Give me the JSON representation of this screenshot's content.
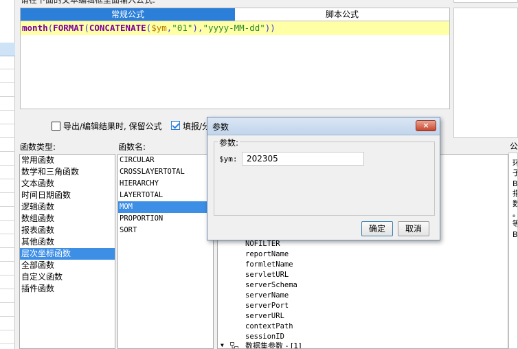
{
  "instruction": "请在下面的文本编辑框里面输入公式:",
  "tabs": {
    "regular": "常规公式",
    "script": "脚本公式"
  },
  "formula": {
    "p1": "month",
    "p2": "(",
    "p3": "FORMAT",
    "p4": "(",
    "p5": "CONCATENATE",
    "p6": "(",
    "p7": "$ym",
    "p8": ",",
    "p9": "\"01\"",
    "p10": ")",
    "p11": ",",
    "p12": "\"yyyy-MM-dd\"",
    "p13": "))"
  },
  "options": {
    "keep_formula": "导出/编辑结果时, 保留公式",
    "fill_report": "填报/分"
  },
  "function_types": {
    "label": "函数类型:",
    "items": [
      "常用函数",
      "数学和三角函数",
      "文本函数",
      "时间日期函数",
      "逻辑函数",
      "数组函数",
      "报表函数",
      "其他函数",
      "层次坐标函数",
      "全部函数",
      "自定义函数",
      "插件函数"
    ],
    "selected_index": 8
  },
  "function_names": {
    "label": "函数名:",
    "items": [
      "CIRCULAR",
      "CROSSLAYERTOTAL",
      "HIERARCHY",
      "LAYERTOTAL",
      "MOM",
      "PROPORTION",
      "SORT"
    ],
    "selected_index": 4
  },
  "tree": {
    "items": [
      "NOFILTER",
      "reportName",
      "formletName",
      "servletURL",
      "serverSchema",
      "serverName",
      "serverPort",
      "serverURL",
      "contextPath",
      "sessionID"
    ],
    "bottom_node": "数据集参数 - [1]"
  },
  "description": {
    "label": "公",
    "lines": [
      "环",
      "子",
      "B",
      "指",
      "数",
      "。",
      "等",
      "B"
    ]
  },
  "dialog": {
    "title": "参数",
    "close": "×",
    "group_label": "参数:",
    "param_label": "$ym:",
    "param_value": "202305",
    "ok": "确定",
    "cancel": "取消"
  },
  "colors": {
    "tab_active": "#2b7fd8",
    "selection": "#3d8ee5",
    "editor_highlight": "#ffffa6",
    "keyword": "#7a00a0",
    "variable": "#b77a00",
    "string": "#2a8a2a"
  }
}
